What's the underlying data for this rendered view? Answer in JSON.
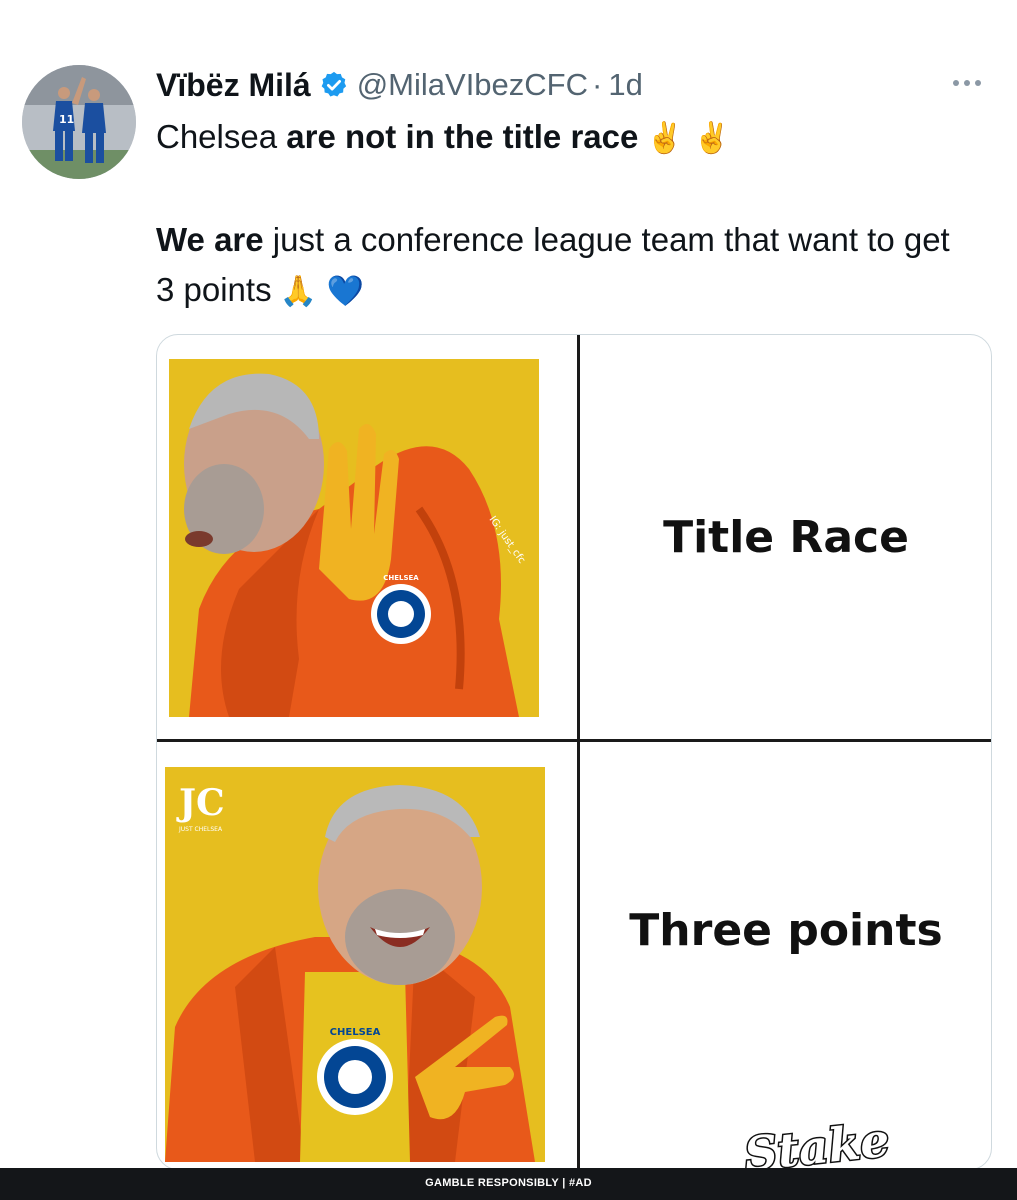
{
  "tweet": {
    "display_name": "Vïbëz Milá",
    "handle": "@MilaVIbezCFC",
    "separator": "·",
    "time": "1d",
    "more_icon": "more-horizontal-icon",
    "verified_color": "#1d9bf0",
    "line1_plain": "Chelsea ",
    "line1_bold": "are not in the title race",
    "line1_emoji": "✌️ ✌️",
    "line2_bold": "We are",
    "line2_plain": " just a conference league team that want to get 3 points",
    "line2_emoji": "🙏 💙"
  },
  "meme": {
    "top_label": "Title Race",
    "bottom_label": "Three points",
    "top_watermark": "IG: just_cfc",
    "top_crest": "CHELSEA FOOTBALL CLUB",
    "bottom_crest": "CHELSEA FOOTBALL CLUB",
    "bottom_logo_text": "JUST CHELSEA"
  },
  "ad": {
    "brand": "Stake",
    "disclaimer": "GAMBLE RESPONSIBLY  |  #AD"
  },
  "colors": {
    "meme_background": "#e6be1f",
    "jacket": "#e8591a",
    "chelsea_blue": "#034694"
  }
}
